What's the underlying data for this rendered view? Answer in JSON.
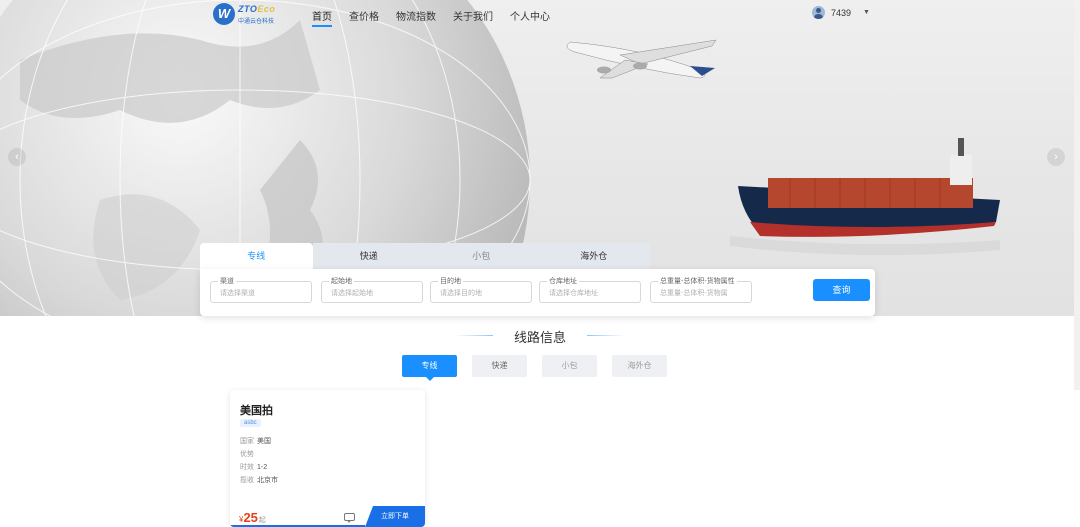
{
  "brand": {
    "mark": "W",
    "name_a": "ZTO",
    "name_b": "Eco",
    "subtitle": "中通云仓科技"
  },
  "nav": {
    "items": [
      {
        "label": "首页"
      },
      {
        "label": "查价格"
      },
      {
        "label": "物流指数"
      },
      {
        "label": "关于我们"
      },
      {
        "label": "个人中心"
      }
    ],
    "active_index": 0
  },
  "user": {
    "name": "7439"
  },
  "hero": {
    "prev": "‹",
    "next": "›"
  },
  "search": {
    "tabs": [
      {
        "label": "专线"
      },
      {
        "label": "快递"
      },
      {
        "label": "小包"
      },
      {
        "label": "海外仓"
      }
    ],
    "fields": [
      {
        "label": "渠道",
        "placeholder": "请选择渠道"
      },
      {
        "label": "起始地",
        "placeholder": "请选择起始地"
      },
      {
        "label": "目的地",
        "placeholder": "请选择目的地"
      },
      {
        "label": "仓库地址",
        "placeholder": "请选择仓库地址"
      },
      {
        "label": "总重量-总体积-货物属性",
        "placeholder": "总重量-总体积-货物属"
      }
    ],
    "button": "查询"
  },
  "section": {
    "title": "线路信息",
    "tabs": [
      {
        "label": "专线"
      },
      {
        "label": "快递"
      },
      {
        "label": "小包"
      },
      {
        "label": "海外仓"
      }
    ]
  },
  "routes": [
    {
      "title": "美国拍",
      "tag": "asbc",
      "rows": [
        {
          "k": "国家",
          "v": "美国"
        },
        {
          "k": "优势",
          "v": ""
        },
        {
          "k": "时效",
          "v": "1-2"
        },
        {
          "k": "揽收",
          "v": "北京市"
        }
      ],
      "currency": "¥",
      "price": "25",
      "price_unit": "起",
      "order_label": "立即下单"
    }
  ],
  "colors": {
    "accent": "#1a8fff",
    "price": "#e5401a"
  }
}
